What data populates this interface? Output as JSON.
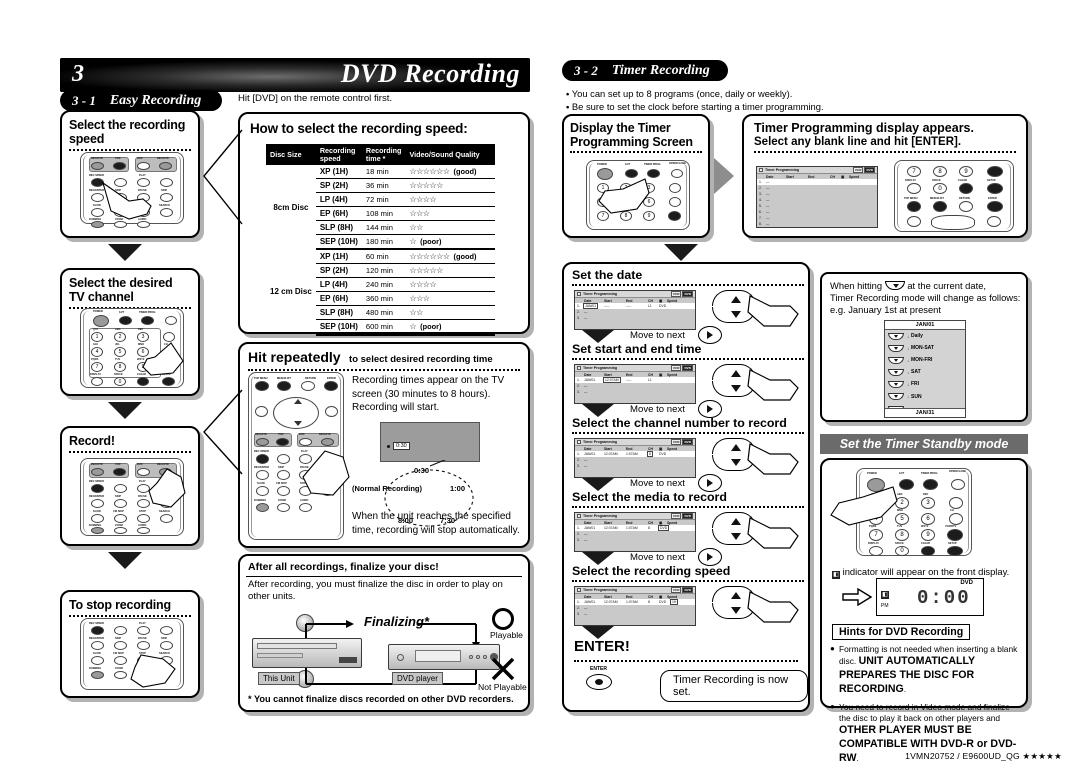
{
  "header": {
    "chapter_number": "3",
    "title": "DVD Recording"
  },
  "section_easy": {
    "pill_number": "3 - 1",
    "pill_label": "Easy Recording",
    "intro": "Hit [DVD] on the remote control first.",
    "steps": [
      {
        "title": "Select the recording speed"
      },
      {
        "title": "Select the desired TV channel"
      },
      {
        "title": "Record!"
      },
      {
        "title": "To stop recording"
      }
    ]
  },
  "speed_guide": {
    "title": "How to select the recording speed:",
    "columns": [
      "Disc Size",
      "Recording speed",
      "Recording time *",
      "Video/Sound Quality"
    ],
    "groups": [
      {
        "disc": "8cm Disc",
        "rows": [
          {
            "speed": "XP (1H)",
            "time": "18 min",
            "stars": "☆☆☆☆☆☆",
            "note": "(good)"
          },
          {
            "speed": "SP  (2H)",
            "time": "36 min",
            "stars": "☆☆☆☆☆",
            "note": ""
          },
          {
            "speed": "LP  (4H)",
            "time": "72 min",
            "stars": "☆☆☆☆",
            "note": ""
          },
          {
            "speed": "EP  (6H)",
            "time": "108 min",
            "stars": "☆☆☆",
            "note": ""
          },
          {
            "speed": "SLP (8H)",
            "time": "144 min",
            "stars": "☆☆",
            "note": ""
          },
          {
            "speed": "SEP (10H)",
            "time": "180 min",
            "stars": "☆",
            "note": "(poor)"
          }
        ]
      },
      {
        "disc": "12 cm Disc",
        "rows": [
          {
            "speed": "XP (1H)",
            "time": "60 min",
            "stars": "☆☆☆☆☆☆",
            "note": "(good)"
          },
          {
            "speed": "SP  (2H)",
            "time": "120 min",
            "stars": "☆☆☆☆☆",
            "note": ""
          },
          {
            "speed": "LP  (4H)",
            "time": "240 min",
            "stars": "☆☆☆☆",
            "note": ""
          },
          {
            "speed": "EP  (6H)",
            "time": "360 min",
            "stars": "☆☆☆",
            "note": ""
          },
          {
            "speed": "SLP (8H)",
            "time": "480 min",
            "stars": "☆☆",
            "note": ""
          },
          {
            "speed": "SEP (10H)",
            "time": "600 min",
            "stars": "☆",
            "note": "(poor)"
          }
        ]
      }
    ]
  },
  "hit_repeatedly": {
    "title_strong": "Hit repeatedly",
    "title_rest": "to select desired recording time",
    "body_1": "Recording times appear on the TV screen (30 minutes to 8 hours). Recording will start.",
    "body_2": "When the unit reaches the specified time, recording will stop automatically.",
    "osd_time": "0:30",
    "cycle": {
      "top": "0:30",
      "right": "1:00",
      "bottom_right": "7:30",
      "bottom_left": "8:00",
      "left_label": "(Normal Recording)"
    }
  },
  "finalize": {
    "title": "After all recordings, finalize your disc!",
    "body": "After recording, you must finalize the disc in order to play on other units.",
    "arrow_label": "Finalizing*",
    "this_unit": "This Unit",
    "dvd_player": "DVD player",
    "playable": "Playable",
    "not_playable": "Not Playable",
    "footnote": "* You cannot finalize discs recorded on other DVD recorders."
  },
  "section_timer": {
    "pill_number": "3 - 2",
    "pill_label": "Timer Recording",
    "notes": [
      "You can set up to 8 programs (once, daily or weekly).",
      "Be sure to set the clock before starting a timer programming."
    ],
    "step_display": {
      "title": "Display the Timer Programming Screen"
    },
    "step_appears": {
      "title_1": "Timer Programming display appears.",
      "title_2": "Select any blank line and hit [ENTER]."
    },
    "osd": {
      "window_title": "Timer Programming",
      "badges": [
        "VCR",
        "DVD"
      ],
      "columns": [
        "Date",
        "Start",
        "End",
        "CH",
        "",
        "Speed"
      ],
      "blank_cell": "—",
      "blank_time": "--:--",
      "line_numbers": [
        "1.",
        "2.",
        "3.",
        "4.",
        "5.",
        "6.",
        "7.",
        "8."
      ]
    },
    "steps": [
      {
        "title": "Set the date",
        "next_label": "Move to next",
        "row": {
          "no": "1.",
          "date": "JAN/01",
          "start": "--:--",
          "end": "--:--",
          "ch": "L1",
          "media": "DVD",
          "speed": "",
          "hl": "date"
        }
      },
      {
        "title": "Set start and end time",
        "next_label": "Move to next",
        "row": {
          "no": "1.",
          "date": "JAN/01",
          "start": "12:07AM",
          "end": "--:--",
          "ch": "L1",
          "media": "",
          "speed": "",
          "hl": "start"
        }
      },
      {
        "title": "Select the channel number to record",
        "next_label": "Move to next",
        "row": {
          "no": "1.",
          "date": "JAN/01",
          "start": "12:07AM",
          "end": "1:07AM",
          "ch": "8",
          "media": "DVD",
          "speed": "",
          "hl": "ch"
        }
      },
      {
        "title": "Select the media to record",
        "next_label": "Move to next",
        "row": {
          "no": "1.",
          "date": "JAN/01",
          "start": "12:07AM",
          "end": "1:07AM",
          "ch": "8",
          "media": "DVD",
          "speed": "",
          "hl": "media"
        }
      },
      {
        "title": "Select the recording speed",
        "next_label": "",
        "row": {
          "no": "1.",
          "date": "JAN/01",
          "start": "12:07AM",
          "end": "1:07AM",
          "ch": "8",
          "media": "DVD",
          "speed": "1H",
          "hl": "speed"
        }
      }
    ],
    "enter": {
      "title": "ENTER!",
      "key_label": "ENTER",
      "confirm": "Timer Recording is now set."
    },
    "date_callout": {
      "line_1a": "When hitting",
      "line_1b": "at the current date,",
      "line_2": "Timer Recording mode will change as follows:",
      "line_3": "e.g. January 1st at present",
      "cycle_top": "JAN/01",
      "cycle_items": [
        "Daily",
        "MON-SAT",
        "MON-FRI",
        "SAT",
        "FRI",
        "SUN"
      ],
      "cycle_bottom": "JAN/31"
    },
    "standby": {
      "title": "Set the Timer Standby mode",
      "indicator_text": "indicator will appear on the front display.",
      "display_label": "DVD",
      "display_time": "0:00",
      "display_pm": "PM"
    },
    "hints": {
      "title": "Hints for DVD Recording",
      "items": [
        {
          "normal_1": "Formatting is not needed when inserting a blank disc. ",
          "bold": "UNIT AUTOMATICALLY PREPARES THE DISC FOR RECORDING",
          "normal_2": "."
        },
        {
          "normal_1": "You need to record in Video mode and finalize the disc to play it back on other players and ",
          "bold": "OTHER PLAYER MUST BE COMPATIBLE WITH DVD-R or DVD-RW",
          "normal_2": "."
        }
      ]
    }
  },
  "remote_labels": {
    "transport": [
      "REC/OTR",
      "VCR",
      "DVD",
      "REC/OTR",
      "REC SPEED",
      "PLAY",
      "REC/ENTER",
      "SKIP",
      "PAUSE",
      "SKIP",
      "SLOW",
      "CM SKIP",
      "STOP",
      "SEARCH",
      "DUBBING",
      "ZOOM",
      "AUDIO"
    ],
    "keypad": [
      "POWER",
      "1/2T",
      "TIMER PROG.",
      "OPEN/CLOSE",
      "@!C",
      "ABC",
      "DEF",
      "GHI",
      "JKL",
      "MNO",
      "CH",
      "PQRS",
      "TUV",
      "WXYZ",
      "VCR/DTV",
      "DISPLAY",
      "SPACE",
      "CLEAR",
      "SETUP"
    ],
    "numbers": [
      "1",
      "2",
      "3",
      "4",
      "5",
      "6",
      "7",
      "8",
      "9",
      "0"
    ],
    "menu": [
      "TOP MENU",
      "MENU/LIST",
      "RETURN",
      "ENTER"
    ]
  },
  "footer": {
    "code": "1VMN20752 / E9600UD_QG ★★★★★"
  }
}
